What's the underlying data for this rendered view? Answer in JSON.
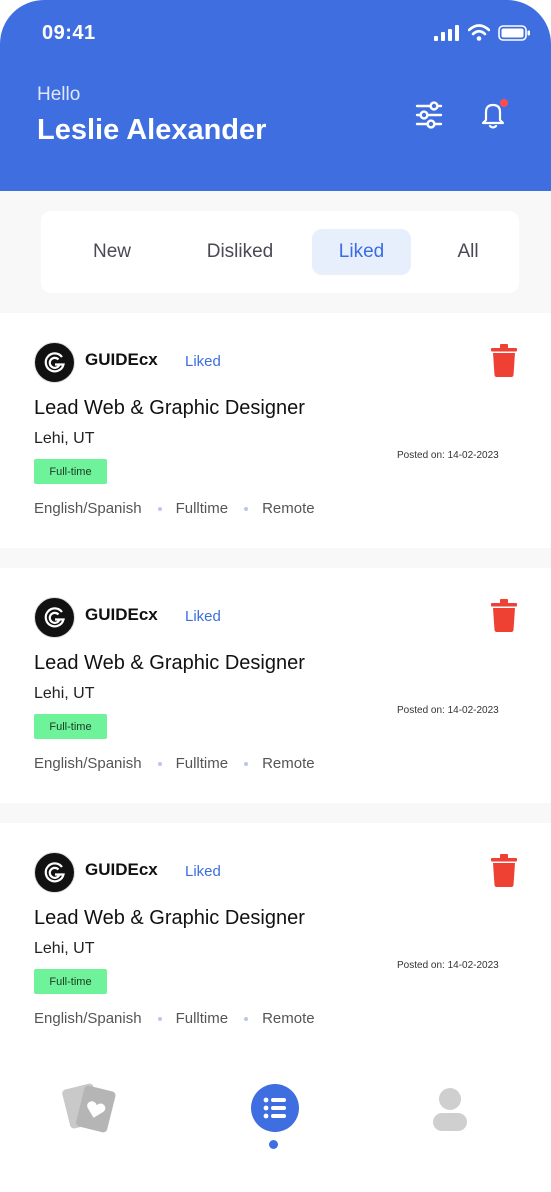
{
  "status_bar": {
    "time": "09:41"
  },
  "header": {
    "greeting": "Hello",
    "user_name": "Leslie Alexander"
  },
  "tabs": [
    {
      "label": "New",
      "active": false
    },
    {
      "label": "Disliked",
      "active": false
    },
    {
      "label": "Liked",
      "active": true
    },
    {
      "label": "All",
      "active": false
    }
  ],
  "jobs": [
    {
      "company": "GUIDEcx",
      "status": "Liked",
      "title": "Lead Web & Graphic Designer",
      "location": "Lehi, UT",
      "employment_badge": "Full-time",
      "posted": "Posted on: 14-02-2023",
      "tags": [
        "English/Spanish",
        "Fulltime",
        "Remote"
      ]
    },
    {
      "company": "GUIDEcx",
      "status": "Liked",
      "title": "Lead Web & Graphic Designer",
      "location": "Lehi, UT",
      "employment_badge": "Full-time",
      "posted": "Posted on: 14-02-2023",
      "tags": [
        "English/Spanish",
        "Fulltime",
        "Remote"
      ]
    },
    {
      "company": "GUIDEcx",
      "status": "Liked",
      "title": "Lead Web & Graphic Designer",
      "location": "Lehi, UT",
      "employment_badge": "Full-time",
      "posted": "Posted on: 14-02-2023",
      "tags": [
        "English/Spanish",
        "Fulltime",
        "Remote"
      ]
    }
  ],
  "icons": {
    "filter": "sliders-icon",
    "notifications": "bell-icon",
    "delete": "trash-icon",
    "nav": [
      "cards-icon",
      "list-icon",
      "profile-icon"
    ]
  },
  "colors": {
    "brand": "#3f6ee0",
    "liked": "#3b6fe0",
    "delete": "#ef4034",
    "badge": "#6ef29a",
    "notification_dot": "#ff4d4d"
  },
  "bottom_nav": {
    "active_index": 1
  }
}
